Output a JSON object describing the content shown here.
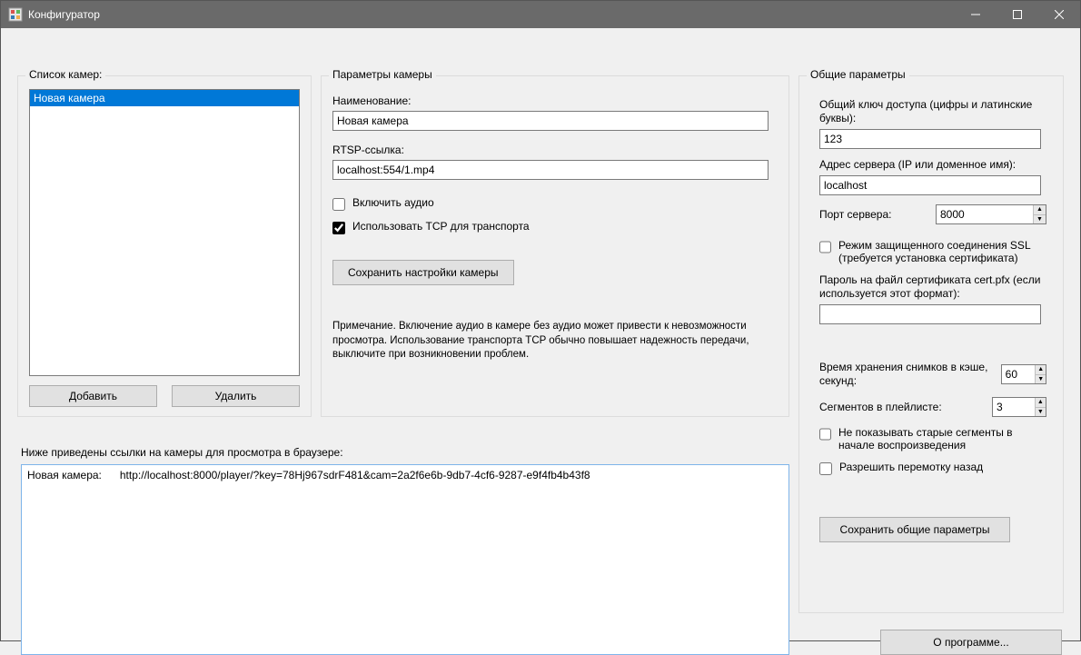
{
  "window": {
    "title": "Конфигуратор"
  },
  "camera_list": {
    "legend": "Список камер:",
    "items": [
      "Новая камера"
    ],
    "selected_index": 0,
    "add_label": "Добавить",
    "delete_label": "Удалить"
  },
  "camera_params": {
    "legend": "Параметры камеры",
    "name_label": "Наименование:",
    "name_value": "Новая камера",
    "rtsp_label": "RTSP-ссылка:",
    "rtsp_value": "localhost:554/1.mp4",
    "audio_label": "Включить аудио",
    "audio_checked": false,
    "tcp_label": "Использовать TCP для транспорта",
    "tcp_checked": true,
    "save_label": "Сохранить настройки камеры",
    "note": "Примечание. Включение аудио в камере без аудио может привести к невозможности просмотра. Использование транспорта TCP обычно повышает надежность передачи, выключите при возникновении проблем."
  },
  "common_params": {
    "legend": "Общие параметры",
    "key_label": "Общий ключ доступа (цифры и латинские буквы):",
    "key_value": "123",
    "server_addr_label": "Адрес сервера (IP или доменное имя):",
    "server_addr_value": "localhost",
    "server_port_label": "Порт сервера:",
    "server_port_value": "8000",
    "ssl_label": "Режим защищенного соединения SSL (требуется установка сертификата)",
    "ssl_checked": false,
    "cert_pass_label": "Пароль на файл сертификата cert.pfx (если используется этот формат):",
    "cert_pass_value": "",
    "cache_seconds_label": "Время хранения снимков в кэше, секунд:",
    "cache_seconds_value": "60",
    "segments_label": "Сегментов в плейлисте:",
    "segments_value": "3",
    "hide_old_segments_label": "Не показывать старые сегменты в начале воспроизведения",
    "hide_old_segments_checked": false,
    "allow_rewind_label": "Разрешить перемотку назад",
    "allow_rewind_checked": false,
    "save_label": "Сохранить общие параметры"
  },
  "links": {
    "label": "Ниже приведены ссылки на камеры для просмотра в браузере:",
    "text": "Новая камера:      http://localhost:8000/player/?key=78Hj967sdrF481&cam=2a2f6e6b-9db7-4cf6-9287-e9f4fb4b43f8\n"
  },
  "about": {
    "label": "О программе..."
  }
}
